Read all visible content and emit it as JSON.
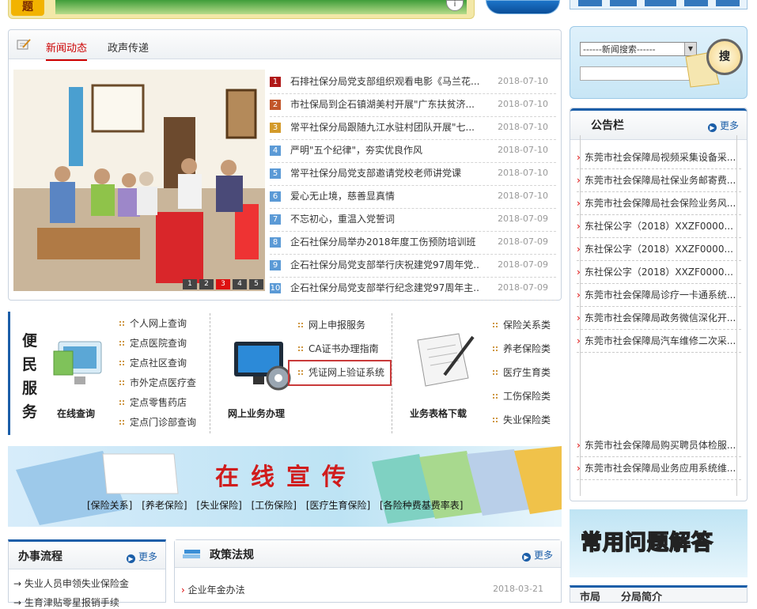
{
  "top": {
    "badge": "题"
  },
  "news": {
    "tabs": [
      "新闻动态",
      "政声传递"
    ],
    "slider_pages": [
      "1",
      "2",
      "3",
      "4",
      "5"
    ],
    "slider_active": 3,
    "items": [
      {
        "n": "1",
        "title": "石排社保分局党支部组织观看电影《马兰花...",
        "date": "2018-07-10",
        "color": "#b01818"
      },
      {
        "n": "2",
        "title": "市社保局到企石镇湖美村开展\"广东扶贫济...",
        "date": "2018-07-10",
        "color": "#c2562a"
      },
      {
        "n": "3",
        "title": "常平社保分局跟随九江水驻村团队开展\"七...",
        "date": "2018-07-10",
        "color": "#d39a2a"
      },
      {
        "n": "4",
        "title": "严明\"五个纪律\"，夯实优良作风",
        "date": "2018-07-10",
        "color": "#5b9ad6"
      },
      {
        "n": "5",
        "title": "常平社保分局党支部邀请党校老师讲党课",
        "date": "2018-07-10",
        "color": "#5b9ad6"
      },
      {
        "n": "6",
        "title": "爱心无止境，慈善显真情",
        "date": "2018-07-10",
        "color": "#5b9ad6"
      },
      {
        "n": "7",
        "title": "不忘初心，重温入党誓词",
        "date": "2018-07-09",
        "color": "#5b9ad6"
      },
      {
        "n": "8",
        "title": "企石社保分局举办2018年度工伤预防培训班",
        "date": "2018-07-09",
        "color": "#5b9ad6"
      },
      {
        "n": "9",
        "title": "企石社保分局党支部举行庆祝建党97周年党...",
        "date": "2018-07-09",
        "color": "#5b9ad6"
      },
      {
        "n": "10",
        "title": "企石社保分局党支部举行纪念建党97周年主...",
        "date": "2018-07-09",
        "color": "#5b9ad6"
      }
    ]
  },
  "services": {
    "title": "便民服务",
    "online_query": {
      "label": "在线查询",
      "links": [
        "个人网上查询",
        "定点医院查询",
        "定点社区查询",
        "市外定点医疗查",
        "定点零售药店",
        "定点门诊部查询"
      ]
    },
    "online_business": {
      "label": "网上业务办理",
      "links": [
        "网上申报服务",
        "CA证书办理指南",
        "凭证网上验证系统"
      ]
    },
    "forms": {
      "label": "业务表格下载",
      "links": [
        "保险关系类",
        "养老保险类",
        "医疗生育类",
        "工伤保险类",
        "失业保险类"
      ]
    }
  },
  "promo": {
    "title": "在线宣传",
    "cats": [
      "[保险关系]",
      "[养老保险]",
      "[失业保险]",
      "[工伤保险]",
      "[医疗生育保险]",
      "[各险种费基费率表]"
    ]
  },
  "procedure": {
    "title": "办事流程",
    "more": "更多",
    "items": [
      "失业人员申领失业保险金",
      "生育津贴零星报销手续"
    ]
  },
  "policy": {
    "title": "政策法规",
    "more": "更多",
    "items": [
      {
        "title": "企业年金办法",
        "date": "2018-03-21"
      }
    ]
  },
  "search": {
    "select": "------新闻搜索------",
    "button": "搜"
  },
  "announcements": {
    "title": "公告栏",
    "more": "更多",
    "items": [
      "东莞市社会保障局视频采集设备采...",
      "东莞市社会保障局社保业务邮寄费...",
      "东莞市社会保障局社会保险业务风...",
      "东社保公字（2018）XXZF0000...",
      "东社保公字（2018）XXZF0000...",
      "东社保公字（2018）XXZF0000...",
      "东莞市社会保障局诊疗一卡通系统...",
      "东莞市社会保障局政务微信深化开...",
      "东莞市社会保障局汽车维修二次采..."
    ],
    "items_bottom": [
      "东莞市社会保障局购买聘员体检服...",
      "东莞市社会保障局业务应用系统维..."
    ]
  },
  "faq": {
    "title": "常用问题解答"
  },
  "bottom_tabs": [
    "市局",
    "分局简介"
  ]
}
